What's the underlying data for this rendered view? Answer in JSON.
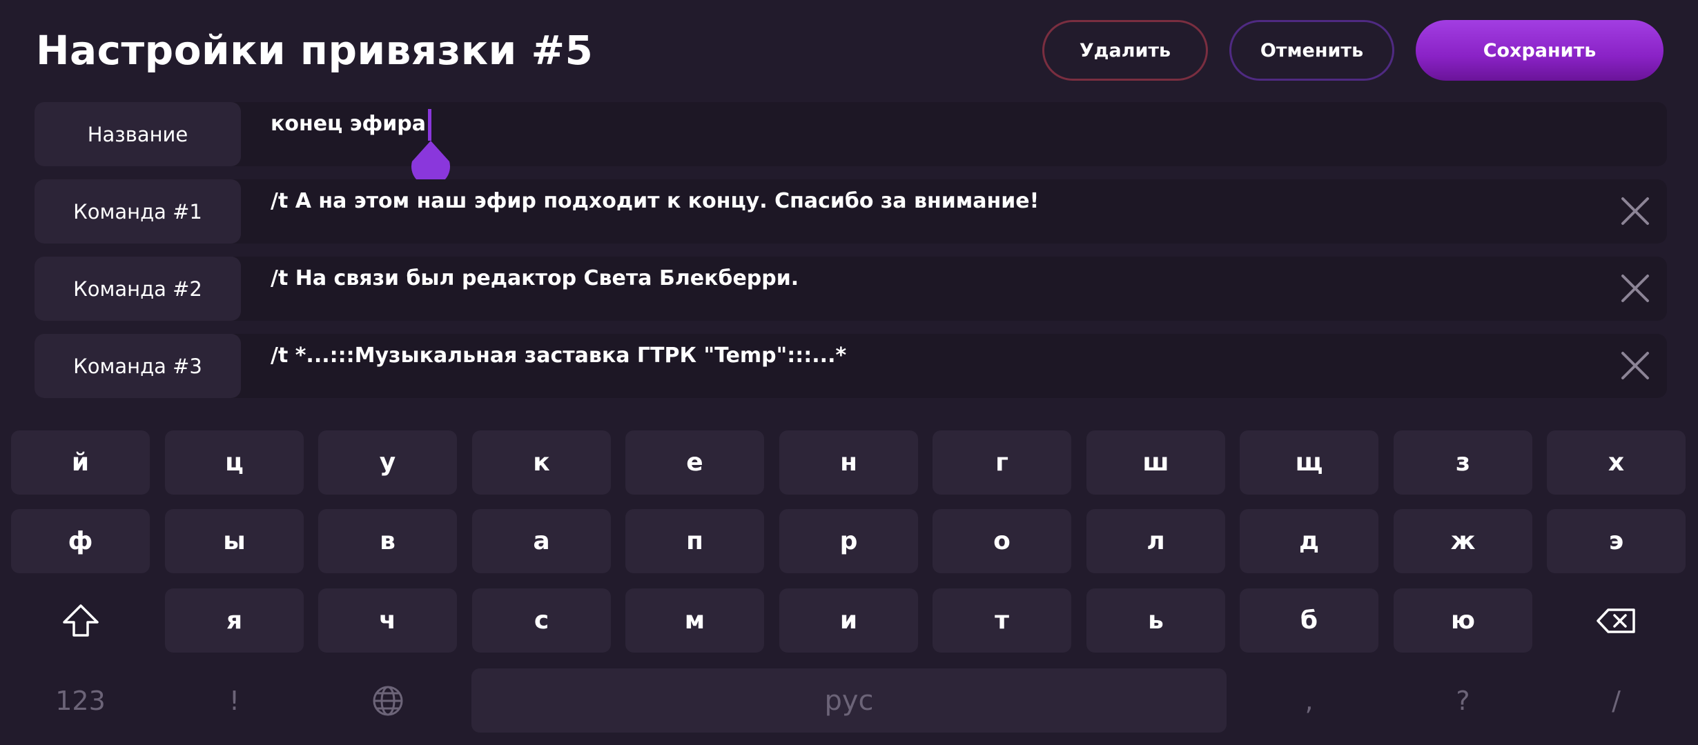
{
  "header": {
    "title": "Настройки привязки #5",
    "delete_label": "Удалить",
    "cancel_label": "Отменить",
    "save_label": "Сохранить"
  },
  "fields": [
    {
      "label": "Название",
      "value": "конец эфира",
      "focused": true
    },
    {
      "label": "Команда #1",
      "value": "/t А на этом наш эфир подходит к концу. Спасибо за внимание!"
    },
    {
      "label": "Команда #2",
      "value": "/t На связи был редактор Света Блекберри."
    },
    {
      "label": "Команда #3",
      "value": "/t *...:::Музыкальная заставка ГТРК \"Temp\":::...*"
    }
  ],
  "keyboard": {
    "row1": [
      "й",
      "ц",
      "у",
      "к",
      "е",
      "н",
      "г",
      "ш",
      "щ",
      "з",
      "х"
    ],
    "row2": [
      "ф",
      "ы",
      "в",
      "а",
      "п",
      "р",
      "о",
      "л",
      "д",
      "ж",
      "э"
    ],
    "row3": [
      "я",
      "ч",
      "с",
      "м",
      "и",
      "т",
      "ь",
      "б",
      "ю"
    ],
    "numbers_key": "123",
    "exclaim_key": "!",
    "space_label": "рус",
    "comma_key": ",",
    "question_key": "?",
    "slash_key": "/"
  },
  "icons": {
    "clear": "close-icon",
    "shift": "shift-icon",
    "backspace": "backspace-icon",
    "language": "globe-icon"
  },
  "colors": {
    "background": "#221b2c",
    "accent": "#8a37dc",
    "delete_border": "#7a2e40",
    "cancel_border": "#4f2a82"
  }
}
